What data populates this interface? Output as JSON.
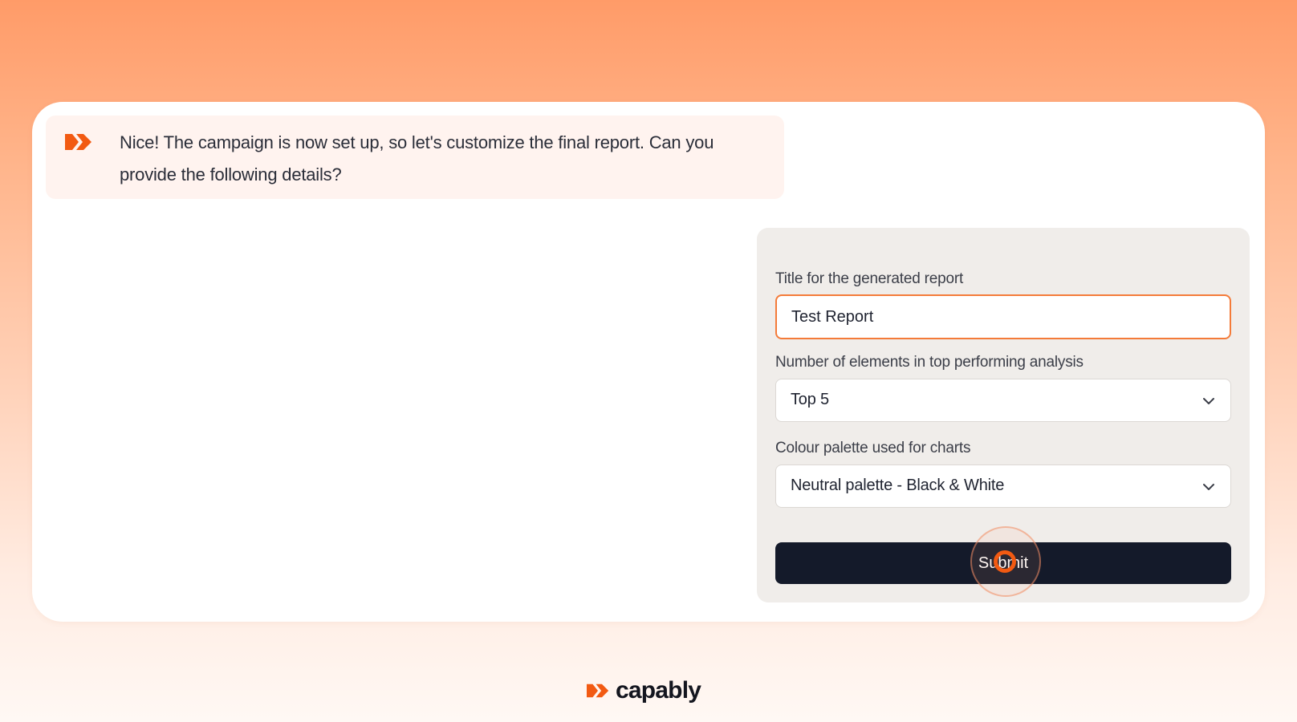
{
  "chat": {
    "message": "Nice! The campaign is now set up, so let's customize the final report. Can you provide the following details?",
    "avatar_icon": "capably-arrow-icon"
  },
  "form": {
    "title_field": {
      "label": "Title for the generated report",
      "value": "Test Report"
    },
    "elements_field": {
      "label": "Number of elements in top performing analysis",
      "selected": "Top 5"
    },
    "palette_field": {
      "label": "Colour palette used for charts",
      "selected": "Neutral palette - Black & White"
    },
    "submit_label": "Submit"
  },
  "brand": {
    "name": "capably"
  },
  "colors": {
    "accent": "#f25a12",
    "button_bg": "#141a2a",
    "input_border_focus": "#f47b39"
  }
}
